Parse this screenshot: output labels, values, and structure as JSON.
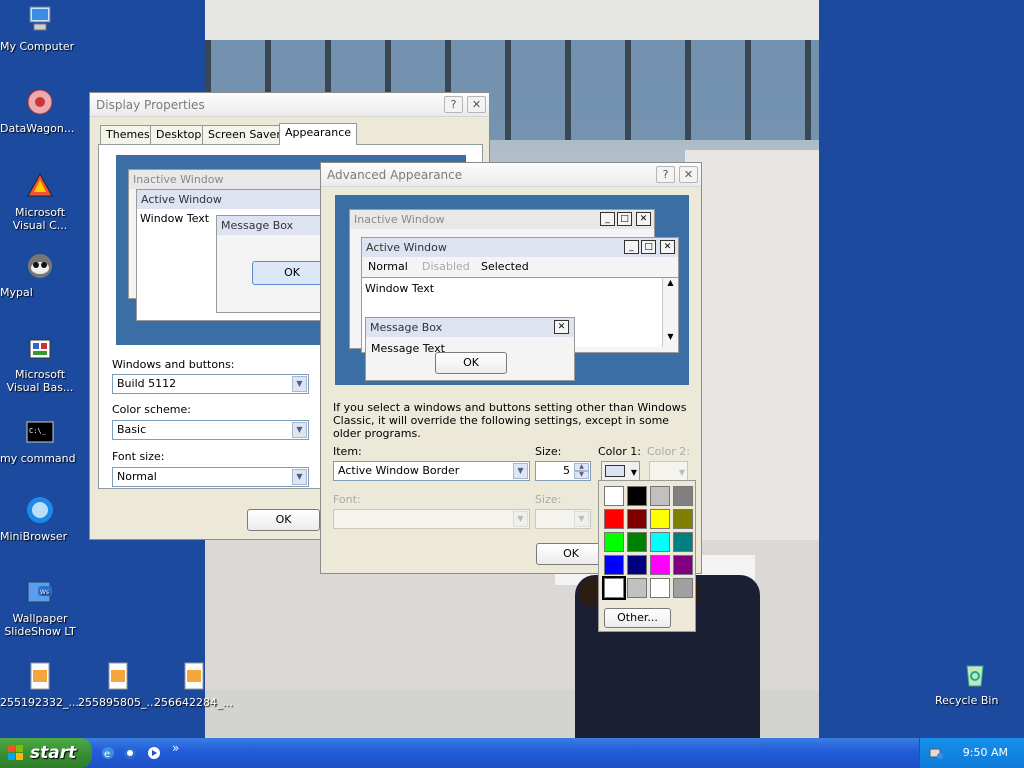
{
  "desktop": {
    "icons": [
      {
        "label": "My Computer",
        "icon": "my-computer-icon"
      },
      {
        "label": "DataWagon...",
        "icon": "datawagon-icon"
      },
      {
        "label": "Microsoft Visual C...",
        "icon": "visual-c-icon"
      },
      {
        "label": "Mypal",
        "icon": "mypal-icon"
      },
      {
        "label": "Microsoft Visual Bas...",
        "icon": "visual-basic-icon"
      },
      {
        "label": "my command",
        "icon": "command-prompt-icon"
      },
      {
        "label": "MiniBrowser",
        "icon": "minibrowser-icon"
      },
      {
        "label": "Wallpaper SlideShow LT",
        "icon": "wallpaper-slideshow-icon"
      },
      {
        "label": "255192332_...",
        "icon": "image-file-icon"
      },
      {
        "label": "255895805_...",
        "icon": "image-file-icon"
      },
      {
        "label": "256642284_...",
        "icon": "image-file-icon"
      },
      {
        "label": "Recycle Bin",
        "icon": "recycle-bin-icon"
      }
    ]
  },
  "display_properties": {
    "title": "Display Properties",
    "help_btn": "?",
    "close_btn": "✕",
    "tabs": [
      "Themes",
      "Desktop",
      "Screen Saver",
      "Appearance"
    ],
    "active_tab": "Appearance",
    "preview": {
      "inactive": "Inactive Window",
      "active": "Active Window",
      "window_text": "Window Text",
      "message_box": "Message Box",
      "ok": "OK"
    },
    "windows_and_buttons_label": "Windows and buttons:",
    "windows_and_buttons_value": "Build 5112",
    "color_scheme_label": "Color scheme:",
    "color_scheme_value": "Basic",
    "font_size_label": "Font size:",
    "font_size_value": "Normal",
    "ok": "OK"
  },
  "advanced_appearance": {
    "title": "Advanced Appearance",
    "help_btn": "?",
    "close_btn": "✕",
    "preview": {
      "inactive": "Inactive Window",
      "active": "Active Window",
      "menu_normal": "Normal",
      "menu_disabled": "Disabled",
      "menu_selected": "Selected",
      "window_text": "Window Text",
      "message_box": "Message Box",
      "message_text": "Message Text",
      "ok": "OK"
    },
    "info_text": "If you select a windows and buttons setting other than Windows Classic, it will override the following settings, except in some older programs.",
    "item_label": "Item:",
    "item_value": "Active Window Border",
    "size_label": "Size:",
    "size_value": "5",
    "color1_label": "Color 1:",
    "color2_label": "Color 2:",
    "font_label": "Font:",
    "font_size_label": "Size:",
    "ok": "OK"
  },
  "color_picker": {
    "colors": [
      "#ffffff",
      "#000000",
      "#c0c0c0",
      "#808080",
      "#ff0000",
      "#800000",
      "#ffff00",
      "#808000",
      "#00ff00",
      "#008000",
      "#00ffff",
      "#008080",
      "#0000ff",
      "#000080",
      "#ff00ff",
      "#800080",
      "#ffffff",
      "#c0c0c0",
      "#ffffff",
      "#a0a0a0"
    ],
    "other": "Other..."
  },
  "taskbar": {
    "start": "start",
    "chevron": "»",
    "clock": "9:50 AM"
  }
}
